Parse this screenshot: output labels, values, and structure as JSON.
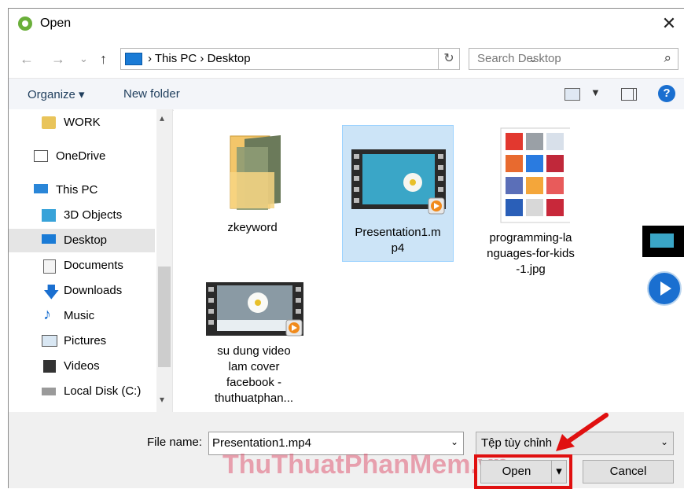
{
  "window": {
    "title": "Open",
    "close_glyph": "✕"
  },
  "address": {
    "back_glyph": "←",
    "forward_glyph": "→",
    "recent_glyph": "⌄",
    "up_glyph": "↑",
    "crumbs": "›  This PC  ›  Desktop",
    "dropdown_glyph": "⌄",
    "refresh_glyph": "↻",
    "search_placeholder": "Search Desktop",
    "search_glyph": "⌕"
  },
  "toolbar": {
    "organize": "Organize ▾",
    "new_folder": "New folder",
    "help": "?"
  },
  "nav": {
    "items": [
      {
        "label": "WORK"
      },
      {
        "label": "OneDrive"
      },
      {
        "label": "This PC"
      },
      {
        "label": "3D Objects"
      },
      {
        "label": "Desktop"
      },
      {
        "label": "Documents"
      },
      {
        "label": "Downloads"
      },
      {
        "label": "Music"
      },
      {
        "label": "Pictures"
      },
      {
        "label": "Videos"
      },
      {
        "label": "Local Disk (C:)"
      }
    ],
    "scroll_up": "▴",
    "scroll_down": "▾"
  },
  "files": [
    {
      "name": "zkeyword"
    },
    {
      "name": "Presentation1.m p4",
      "line1": "Presentation1.m",
      "line2": "p4"
    },
    {
      "name": "programming-languages-for-kids-1.jpg",
      "line1": "programming-la",
      "line2": "nguages-for-kids",
      "line3": "-1.jpg"
    },
    {
      "name": "su dung video lam cover facebook - thuthuatphan...",
      "line1": "su dung video",
      "line2": "lam cover",
      "line3": "facebook -",
      "line4": "thuthuatphan..."
    }
  ],
  "bottom": {
    "file_name_label": "File name:",
    "file_name_value": "Presentation1.mp4",
    "file_type_value": "Tệp tùy chỉnh",
    "open_button": "Open",
    "open_split": "▾",
    "cancel_button": "Cancel",
    "dropdown_glyph": "⌄",
    "watermark": "ThuThuatPhanMem.vn"
  },
  "colors": {
    "selection": "#cce4f7",
    "annotation_red": "#e01010",
    "accent": "#1a6fd0"
  }
}
